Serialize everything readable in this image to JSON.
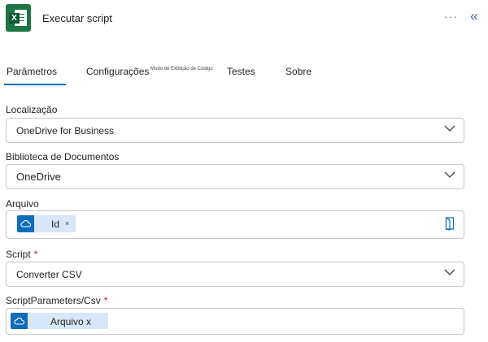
{
  "header": {
    "title": "Executar script",
    "more_glyph": "···",
    "collapse_glyph": "«",
    "app_icon": "excel-icon"
  },
  "tabs": [
    {
      "label": "Parâmetros",
      "active": true
    },
    {
      "label": "Configurações"
    },
    {
      "label": "Modo de Exibição de Código"
    },
    {
      "label": "Testes"
    },
    {
      "label": "Sobre"
    }
  ],
  "fields": {
    "location": {
      "label": "Localização",
      "value": "OneDrive for Business"
    },
    "doc_library": {
      "label": "Biblioteca de Documentos",
      "value": "OneDrive"
    },
    "file": {
      "label": "Arquivo",
      "token": "Id",
      "token_icon": "cloud-icon",
      "remove_glyph": "×"
    },
    "script": {
      "label": "Script",
      "required_mark": "*",
      "value": "Converter CSV"
    },
    "csv": {
      "label": "ScriptParameters/Csv",
      "required_mark": "*",
      "token": "Arquivo x",
      "token_icon": "cloud-icon"
    }
  },
  "colors": {
    "accent": "#0f6cbd",
    "excel_green": "#1d7544",
    "required": "#c50f1f",
    "token_bg": "#d7e7f7"
  }
}
